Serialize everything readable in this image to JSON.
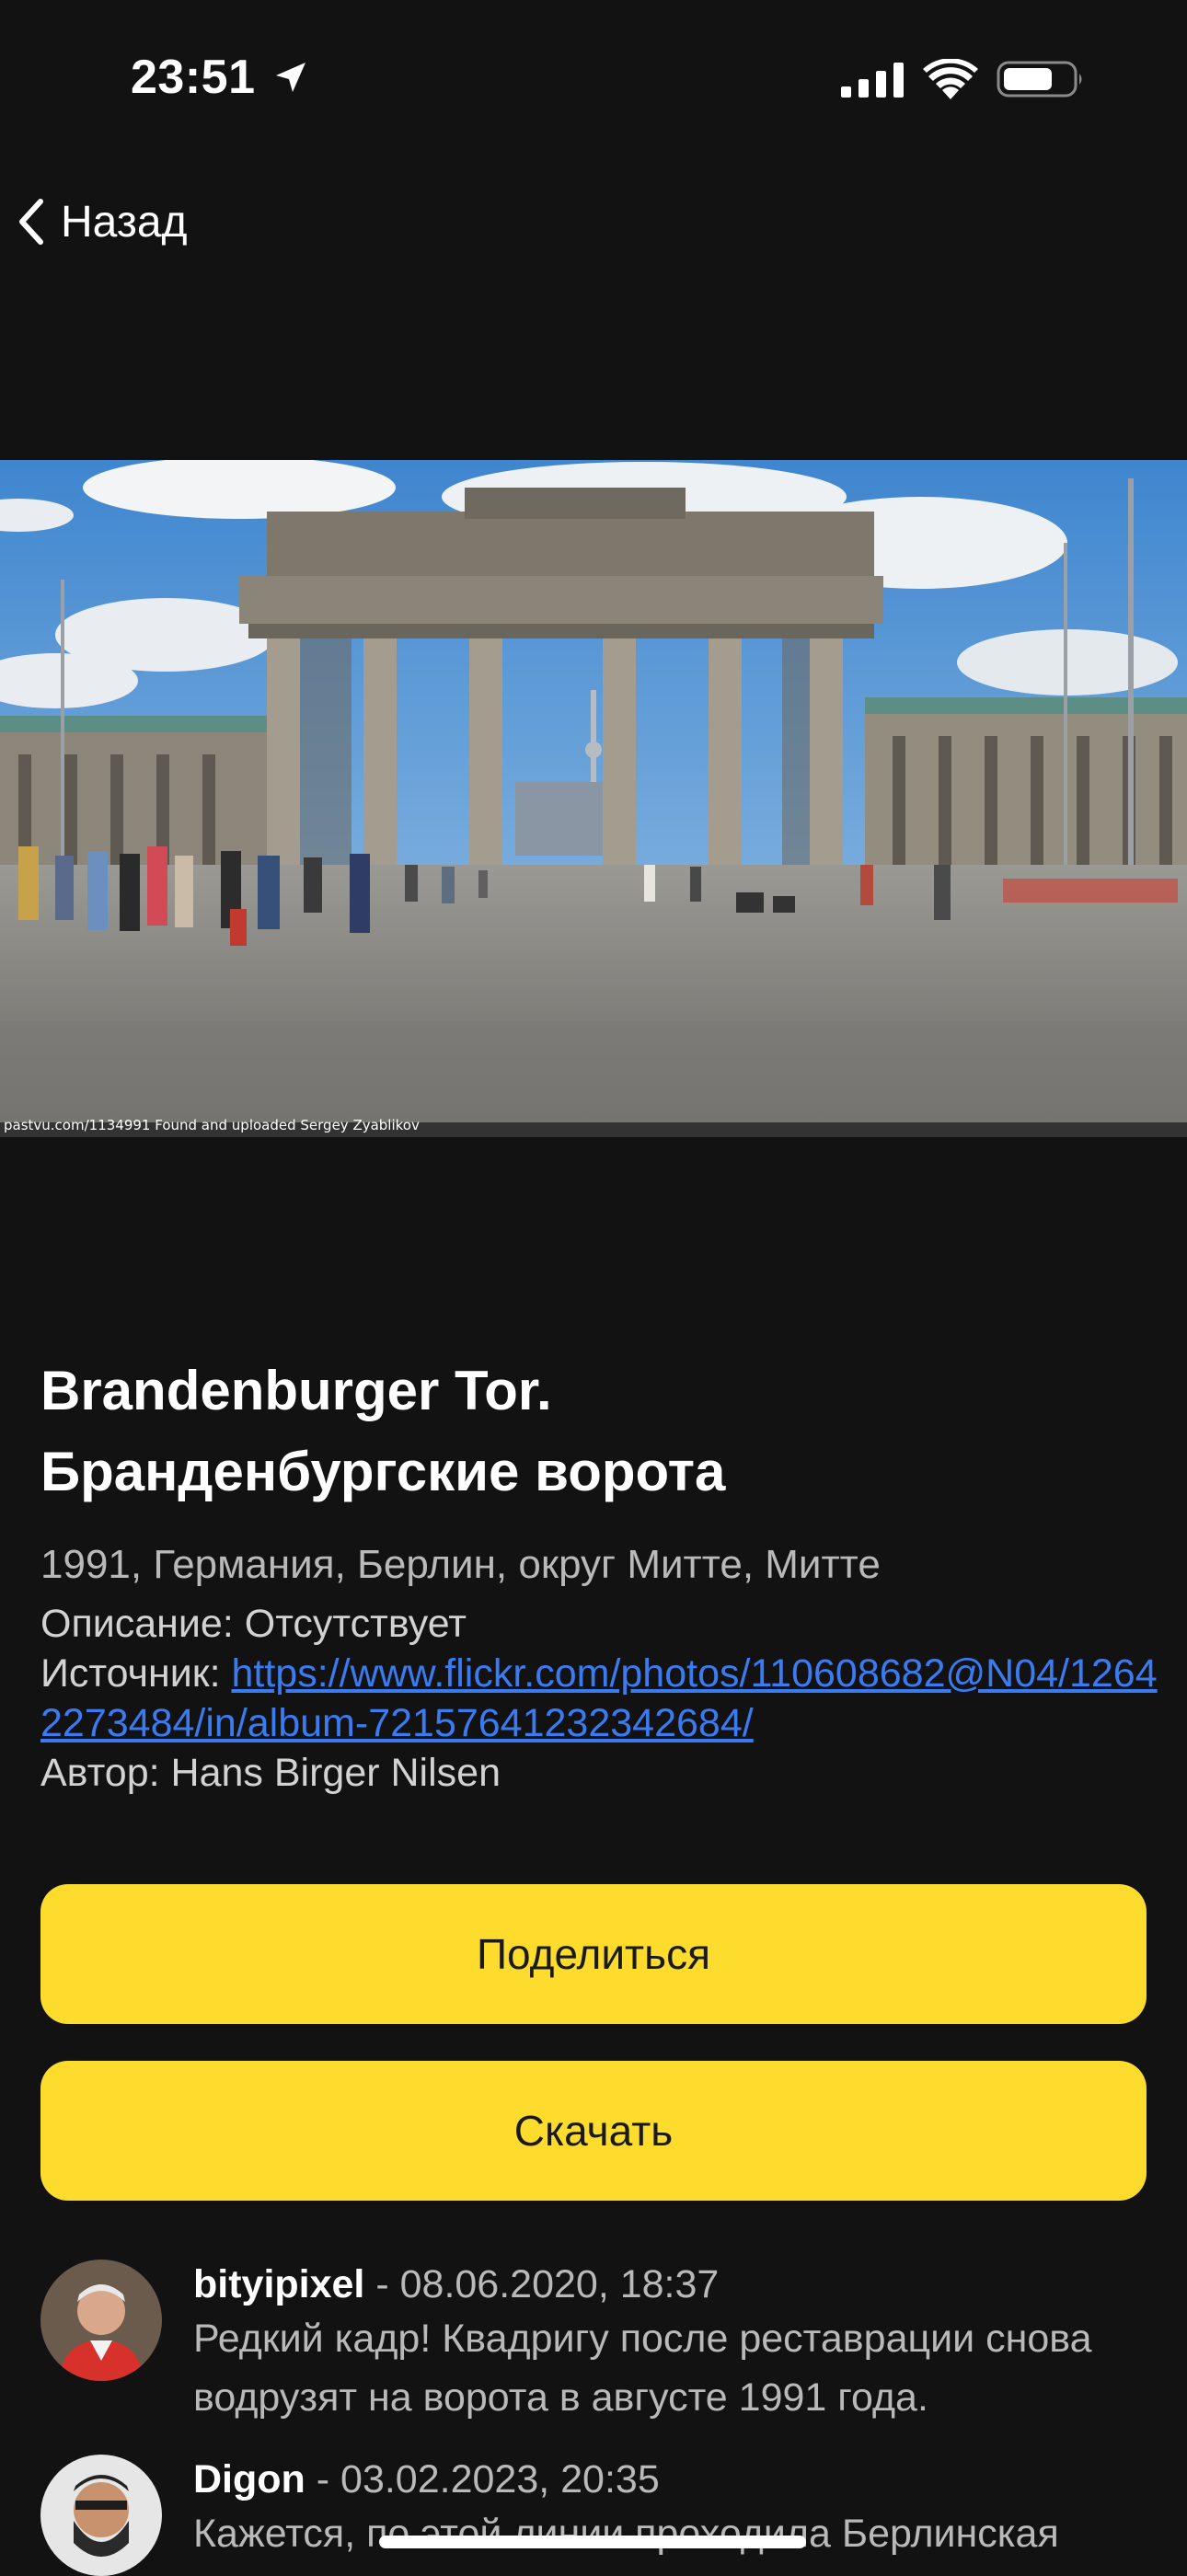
{
  "status_bar": {
    "time": "23:51"
  },
  "nav": {
    "back_label": "Назад"
  },
  "photo": {
    "watermark": "pastvu.com/1134991  Found and uploaded Sergey Zyablikov"
  },
  "info": {
    "title_line1": "Brandenburger Tor.",
    "title_line2": "Бранденбургские ворота",
    "subtitle": "1991, Германия, Берлин, округ Митте, Митте",
    "description_label": "Описание: ",
    "description_value": "Отсутствует",
    "source_label": "Источник: ",
    "source_url": "https://www.flickr.com/photos/110608682@N04/12642273484/in/album-72157641232342684/",
    "author_label": "Автор: ",
    "author_value": "Hans Birger Nilsen"
  },
  "actions": {
    "share_label": "Поделиться",
    "download_label": "Скачать"
  },
  "comments": [
    {
      "author": "bityipixel",
      "separator": " - ",
      "date": "08.06.2020, 18:37",
      "text": "Редкий кадр! Квадригу после реставрации снова водрузят на ворота в августе 1991 года."
    },
    {
      "author": "Digon",
      "separator": " - ",
      "date": "03.02.2023, 20:35",
      "text": "Кажется, по этой линии проходила Берлинская"
    }
  ],
  "colors": {
    "background": "#121212",
    "accent": "#fddc2e",
    "link": "#3a7bf2",
    "secondary_text": "#b9b9b9"
  },
  "icons": {
    "location": "location-arrow-icon",
    "signal": "cellular-signal-icon",
    "wifi": "wifi-icon",
    "battery": "battery-icon",
    "back": "chevron-left-icon"
  }
}
